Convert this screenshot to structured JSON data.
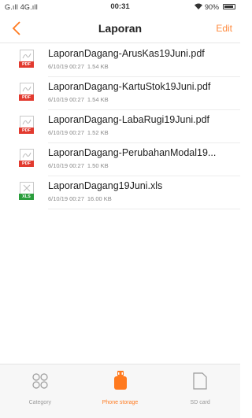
{
  "status_bar": {
    "left": "G.ıll 4G.ıll",
    "time": "00:31",
    "battery": "90%"
  },
  "header": {
    "title": "Laporan",
    "edit_label": "Edit"
  },
  "files": [
    {
      "name": "LaporanDagang-ArusKas19Juni.pdf",
      "date": "6/10/19 00:27",
      "size": "1.54 KB",
      "type": "PDF"
    },
    {
      "name": "LaporanDagang-KartuStok19Juni.pdf",
      "date": "6/10/19 00:27",
      "size": "1.54 KB",
      "type": "PDF"
    },
    {
      "name": "LaporanDagang-LabaRugi19Juni.pdf",
      "date": "6/10/19 00:27",
      "size": "1.52 KB",
      "type": "PDF"
    },
    {
      "name": "LaporanDagang-PerubahanModal19...",
      "date": "6/10/19 00:27",
      "size": "1.50 KB",
      "type": "PDF"
    },
    {
      "name": "LaporanDagang19Juni.xls",
      "date": "6/10/19 00:27",
      "size": "16.00 KB",
      "type": "XLS"
    }
  ],
  "tabs": [
    {
      "label": "Category",
      "icon": "category-icon",
      "active": false
    },
    {
      "label": "Phone storage",
      "icon": "phone-storage-icon",
      "active": true
    },
    {
      "label": "SD card",
      "icon": "sd-card-icon",
      "active": false
    }
  ],
  "colors": {
    "accent": "#ff7a1f",
    "pdf_badge": "#e23a2f",
    "xls_badge": "#2a9d3c"
  }
}
